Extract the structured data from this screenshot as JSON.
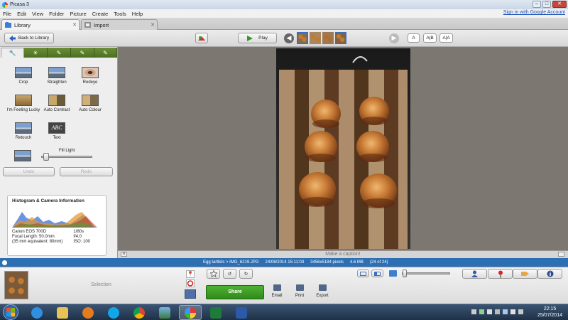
{
  "window": {
    "title": "Picasa 3",
    "minimize": "–",
    "maximize": "□",
    "close": "✕"
  },
  "menu": {
    "items": [
      "File",
      "Edit",
      "View",
      "Folder",
      "Picture",
      "Create",
      "Tools",
      "Help"
    ],
    "signin": "Sign in with Google Account"
  },
  "tabs": [
    {
      "label": "Library",
      "close": "✕"
    },
    {
      "label": "Import",
      "close": "✕"
    }
  ],
  "toolbar": {
    "back_label": "Back to Library",
    "play_label": "Play",
    "caption_modes": [
      "A",
      "A|B",
      "A|A"
    ]
  },
  "panel": {
    "tools": [
      {
        "label": "Crop"
      },
      {
        "label": "Straighten"
      },
      {
        "label": "Redeye"
      },
      {
        "label": "I'm Feeling Lucky"
      },
      {
        "label": "Auto Contrast"
      },
      {
        "label": "Auto Colour"
      },
      {
        "label": "Retouch"
      },
      {
        "label": "Text"
      }
    ],
    "text_thumb": "ABC",
    "fill_light_label": "Fill Light",
    "fill_light_value": 0.05,
    "undo_label": "Undo",
    "redo_label": "Redo",
    "histogram": {
      "title": "Histogram & Camera Information",
      "camera": "Canon EOS 700D",
      "focal": "Focal Length: 50.0mm",
      "equiv": "(35 mm equivalent: 80mm)",
      "shutter": "1/80s",
      "aperture": "f/4.0",
      "iso": "ISO: 100"
    }
  },
  "caption_placeholder": "Make a caption!",
  "info": {
    "path": "Egg tartlets > IMG_6219.JPG",
    "datetime": "24/06/2014 15:11:03",
    "dimensions": "3456x5184 pixels",
    "size": "4.6 MB",
    "position": "(24 of 24)"
  },
  "bottom": {
    "selection_label": "Selection",
    "share_label": "Share",
    "email_label": "Email",
    "print_label": "Print",
    "export_label": "Export",
    "zoom_value": 0.02
  },
  "taskbar": {
    "time": "22:15",
    "date": "25/07/2014"
  },
  "colors": {
    "accent_green": "#3a9d23",
    "info_blue": "#2d6fb3",
    "tool_tab_green": "#5a7e2c"
  }
}
